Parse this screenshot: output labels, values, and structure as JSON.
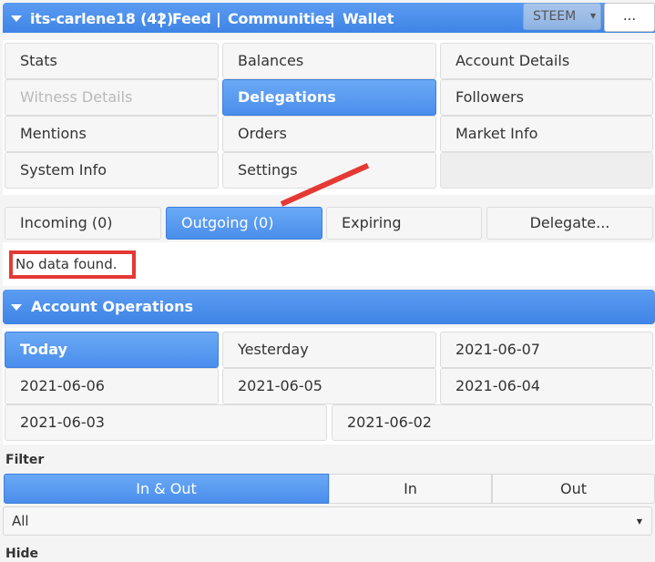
{
  "header": {
    "account": "its-carlene18 (42)",
    "sep": "|",
    "feed": "Feed",
    "communities": "Communities",
    "wallet": "Wallet",
    "currency": "STEEM",
    "more": "..."
  },
  "menu": {
    "stats": "Stats",
    "balances": "Balances",
    "account_details": "Account Details",
    "witness_details": "Witness Details",
    "delegations": "Delegations",
    "followers": "Followers",
    "mentions": "Mentions",
    "orders": "Orders",
    "market_info": "Market Info",
    "system_info": "System Info",
    "settings": "Settings"
  },
  "delegation_tabs": {
    "incoming": "Incoming (0)",
    "outgoing": "Outgoing (0)",
    "expiring": "Expiring",
    "delegate": "Delegate..."
  },
  "empty_message": "No data found.",
  "account_operations": {
    "title": "Account Operations",
    "dates": [
      "Today",
      "Yesterday",
      "2021-06-07",
      "2021-06-06",
      "2021-06-05",
      "2021-06-04",
      "2021-06-03",
      "2021-06-02"
    ]
  },
  "filter": {
    "label": "Filter",
    "options": [
      "In & Out",
      "In",
      "Out"
    ],
    "type_value": "All",
    "hide_label": "Hide"
  },
  "colors": {
    "accent": "#4a8eec",
    "annotation": "#e53935"
  }
}
